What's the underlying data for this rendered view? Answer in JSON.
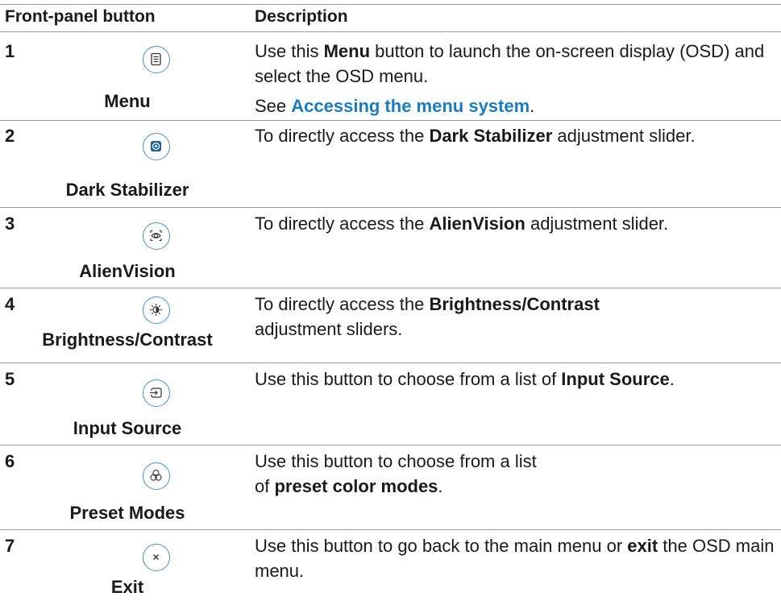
{
  "header": {
    "col1": "Front-panel button",
    "col2": "Description"
  },
  "rows": [
    {
      "number": "1",
      "icon": "menu-icon",
      "label": "Menu",
      "desc": [
        {
          "t": "Use this "
        },
        {
          "t": "Menu",
          "b": true
        },
        {
          "t": " button to launch the on-screen display (OSD) and select the OSD menu."
        }
      ],
      "desc2": [
        {
          "t": "See "
        },
        {
          "t": "Accessing the menu system",
          "link": true
        },
        {
          "t": "."
        }
      ]
    },
    {
      "number": "2",
      "icon": "dark-stabilizer-icon",
      "label": "Dark Stabilizer",
      "desc": [
        {
          "t": "To directly access the "
        },
        {
          "t": "Dark Stabilizer",
          "b": true
        },
        {
          "t": " adjustment slider."
        }
      ]
    },
    {
      "number": "3",
      "icon": "alienvision-icon",
      "label": "AlienVision",
      "desc": [
        {
          "t": "To directly access the "
        },
        {
          "t": "AlienVision",
          "b": true
        },
        {
          "t": " adjustment slider."
        }
      ]
    },
    {
      "number": "4",
      "icon": "brightness-icon",
      "label": "Brightness/Contrast",
      "desc": [
        {
          "t": "To directly access the "
        },
        {
          "t": "Brightness/Contrast",
          "b": true
        },
        {
          "t": " adjustment sliders."
        }
      ]
    },
    {
      "number": "5",
      "icon": "input-source-icon",
      "label": "Input Source",
      "desc": [
        {
          "t": "Use this button to choose from a list of "
        },
        {
          "t": "Input Source",
          "b": true
        },
        {
          "t": "."
        }
      ]
    },
    {
      "number": "6",
      "icon": "preset-modes-icon",
      "label": "Preset Modes",
      "desc": [
        {
          "t": "Use this button to choose from a list of "
        },
        {
          "t": "preset color modes",
          "b": true
        },
        {
          "t": "."
        }
      ]
    },
    {
      "number": "7",
      "icon": "exit-icon",
      "label": "Exit",
      "desc": [
        {
          "t": "Use this button to go back to the main menu or "
        },
        {
          "t": "exit",
          "b": true
        },
        {
          "t": " the OSD main menu."
        }
      ]
    }
  ],
  "colors": {
    "rule": "#9a9a9a",
    "icon_border": "#4a8fc2",
    "link": "#1a7bc1",
    "text": "#1a1a1a"
  }
}
